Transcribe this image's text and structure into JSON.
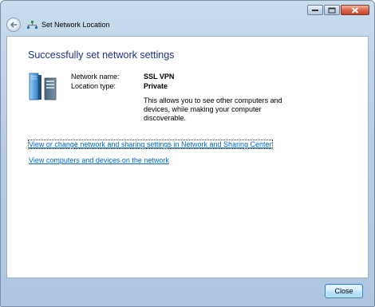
{
  "window": {
    "title": "Set Network Location"
  },
  "content": {
    "heading": "Successfully set network settings",
    "network_name_label": "Network name:",
    "network_name_value": "SSL VPN",
    "location_type_label": "Location type:",
    "location_type_value": "Private",
    "description": "This allows you to see other computers and devices, while making your computer discoverable.",
    "link_sharing_center": "View or change network and sharing settings in Network and Sharing Center",
    "link_computers_devices": "View computers and devices on the network"
  },
  "footer": {
    "close_label": "Close"
  },
  "icons": {
    "back": "back-arrow-icon",
    "network": "network-icon",
    "server": "server-icon",
    "minimize": "minimize-icon",
    "maximize": "maximize-icon",
    "close": "close-icon"
  },
  "colors": {
    "heading": "#1e3287",
    "link": "#0066cc",
    "frame": "#b6cde6"
  }
}
